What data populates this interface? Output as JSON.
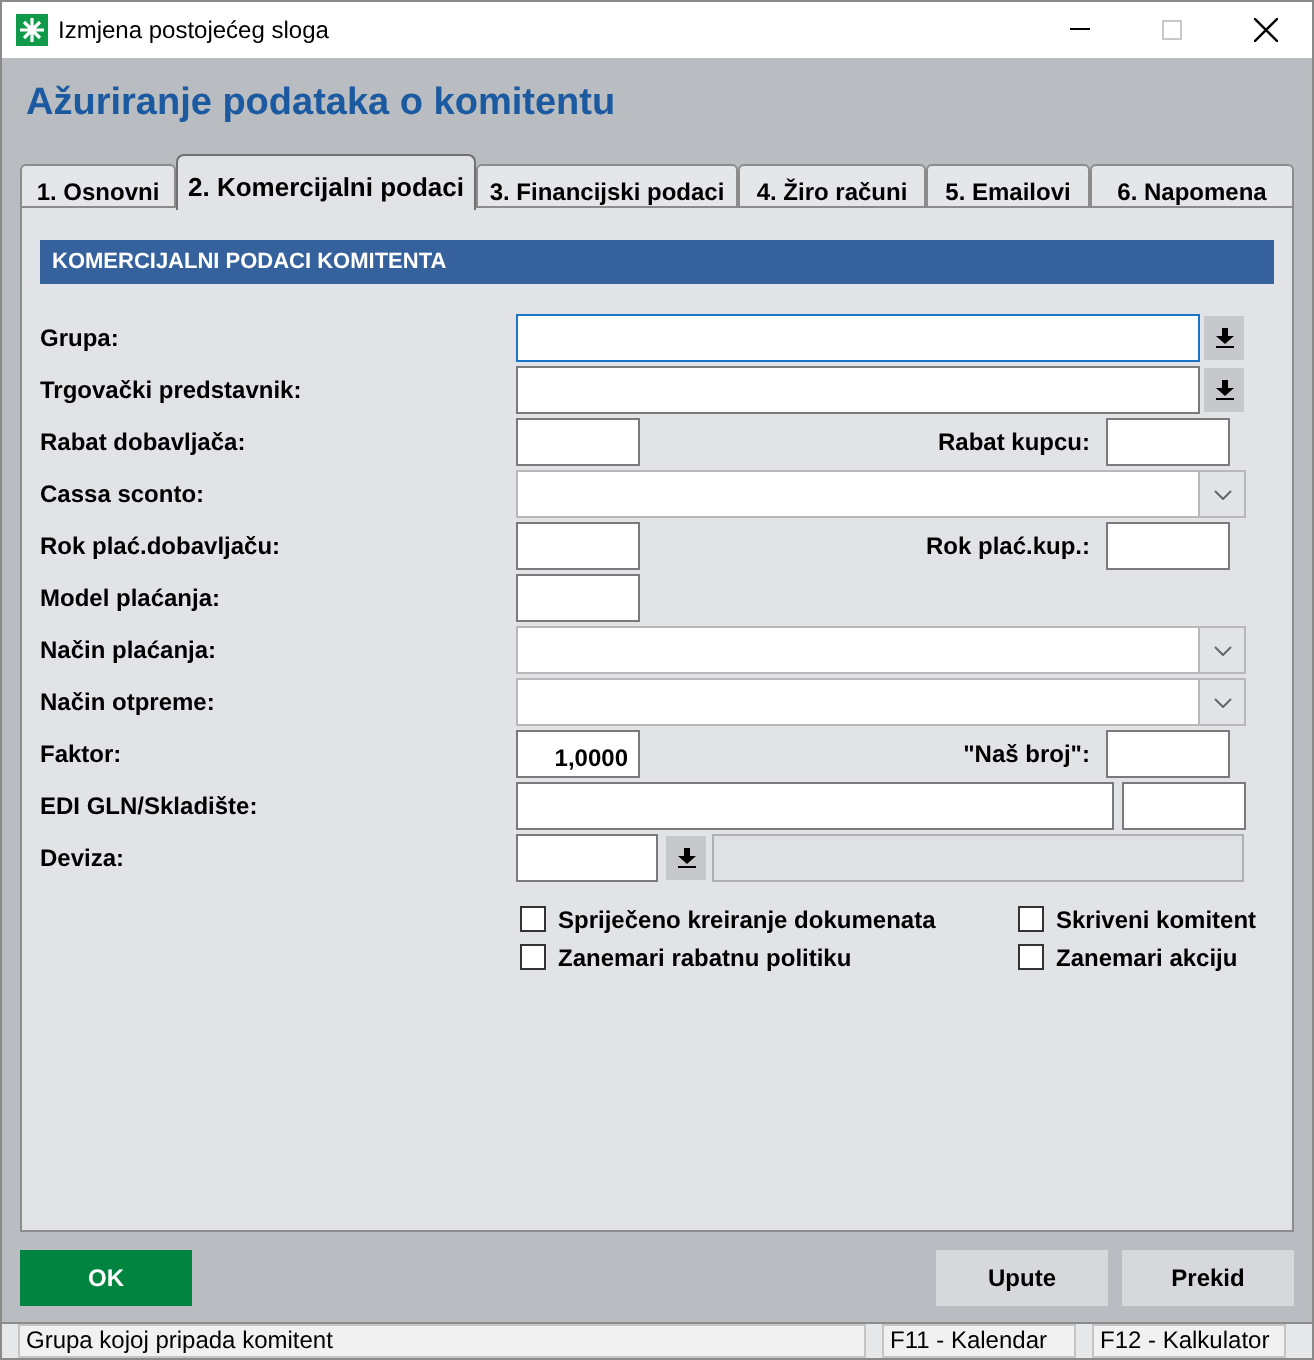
{
  "window": {
    "title": "Izmjena postojećeg sloga"
  },
  "heading": "Ažuriranje podataka o komitentu",
  "tabs": [
    {
      "label": "1. Osnovni",
      "selected": false
    },
    {
      "label": "2. Komercijalni podaci",
      "selected": true
    },
    {
      "label": "3. Financijski podaci",
      "selected": false
    },
    {
      "label": "4. Žiro računi",
      "selected": false
    },
    {
      "label": "5. Emailovi",
      "selected": false
    },
    {
      "label": "6. Napomena",
      "selected": false
    }
  ],
  "section_title": "KOMERCIJALNI PODACI KOMITENTA",
  "fields": [
    {
      "kind": "lookup",
      "label": "Grupa:",
      "focused": true
    },
    {
      "kind": "lookup",
      "label": "Trgovački predstavnik:",
      "focused": false
    },
    {
      "kind": "pair",
      "label": "Rabat dobavljača:",
      "right_label": "Rabat kupcu:"
    },
    {
      "kind": "combo",
      "label": "Cassa sconto:"
    },
    {
      "kind": "pair",
      "label": "Rok plać.dobavljaču:",
      "right_label": "Rok plać.kup.:"
    },
    {
      "kind": "small",
      "label": "Model plaćanja:"
    },
    {
      "kind": "combo",
      "label": "Način plaćanja:"
    },
    {
      "kind": "combo",
      "label": "Način otpreme:"
    },
    {
      "kind": "pair",
      "label": "Faktor:",
      "value": "1,0000",
      "right_label": "\"Naš broj\":"
    },
    {
      "kind": "split",
      "label": "EDI GLN/Skladište:"
    },
    {
      "kind": "currency",
      "label": "Deviza:"
    }
  ],
  "checkboxes": [
    {
      "label": "Spriječeno kreiranje dokumenata",
      "checked": false
    },
    {
      "label": "Skriveni komitent",
      "checked": false
    },
    {
      "label": "Zanemari rabatnu politiku",
      "checked": false
    },
    {
      "label": "Zanemari akciju",
      "checked": false
    }
  ],
  "buttons": [
    {
      "label": "OK",
      "kind": "primary"
    },
    {
      "label": "Upute",
      "kind": "normal"
    },
    {
      "label": "Prekid",
      "kind": "normal"
    }
  ],
  "status_bar": [
    "Grupa kojoj pripada komitent",
    "F11 - Kalendar",
    "F12 - Kalkulator"
  ]
}
